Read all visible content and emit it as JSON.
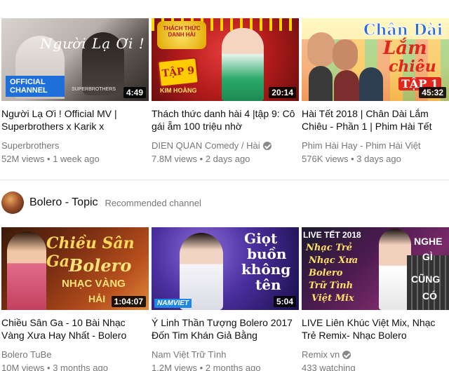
{
  "row1": [
    {
      "title": "Người Lạ Ơi ! Official MV | Superbrothers x Karik x",
      "channel": "Superbrothers",
      "verified": false,
      "views": "52M views",
      "age": "1 week ago",
      "duration": "4:49",
      "overlay": {
        "script": "Người Lạ Ơi !",
        "badge": "OFFICIAL CHANNEL",
        "credit": "SUPERBROTHERS"
      }
    },
    {
      "title": "Thách thức danh hài 4 |tập 9: Cô gái ẵm 100 triệu nhờ",
      "channel": "DIEN QUAN Comedy / Hài",
      "verified": true,
      "views": "7.8M views",
      "age": "2 days ago",
      "duration": "20:14",
      "overlay": {
        "badge": "TẬP 9",
        "sub": "KIM HOÀNG"
      }
    },
    {
      "title": "Hài Tết 2018 | Chân Dài Lắm Chiêu - Phần 1 | Phim Hài Tết",
      "channel": "Phim Hài Hay - Phim Hài Việt",
      "verified": false,
      "views": "576K views",
      "age": "3 days ago",
      "duration": "45:32",
      "overlay": {
        "line1": "Chân Dài",
        "line2": "Lắm",
        "line3": "chiêu",
        "badge": "TẬP 1"
      }
    }
  ],
  "shelf": {
    "title": "Bolero - Topic",
    "subtitle": "Recommended channel"
  },
  "row2": [
    {
      "title": "Chiều Sân Ga - 10 Bài Nhạc Vàng Xưa Hay Nhất - Bolero",
      "channel": "Bolero TuBe",
      "verified": false,
      "views": "10M views",
      "age": "3 months ago",
      "duration": "1:04:07",
      "overlay": {
        "line1": "Chiều Sân Ga",
        "line2": "Bolero",
        "line3": "NHẠC VÀNG",
        "line4": "HẢI"
      }
    },
    {
      "title": "Ý Linh Thần Tượng Bolero 2017 Đốn Tim Khán Giả Bằng",
      "channel": "Nam Việt Trữ Tình",
      "verified": false,
      "views": "1.2M views",
      "age": "2 months ago",
      "duration": "5:04",
      "overlay": {
        "line1": "Giọt",
        "line2": "buồn",
        "line3": "không",
        "line4": "tên",
        "badge": "NAMVIET"
      }
    },
    {
      "title": "LIVE Liên Khúc Việt Mix, Nhạc Trẻ Remix- Nhạc Bolero",
      "channel": "Remix vn",
      "verified": true,
      "views": "433 watching",
      "age": "",
      "duration": "",
      "overlay": {
        "top": "LIVE TẾT 2018",
        "l1": "Nhạc Trẻ",
        "l2": "Nhạc Xưa",
        "l3": "Bolero",
        "l4": "Trữ Tình",
        "l5": "Việt Mix",
        "r1": "NGHE",
        "r2": "GÌ",
        "r3": "CŨNG",
        "r4": "CÓ"
      }
    }
  ]
}
